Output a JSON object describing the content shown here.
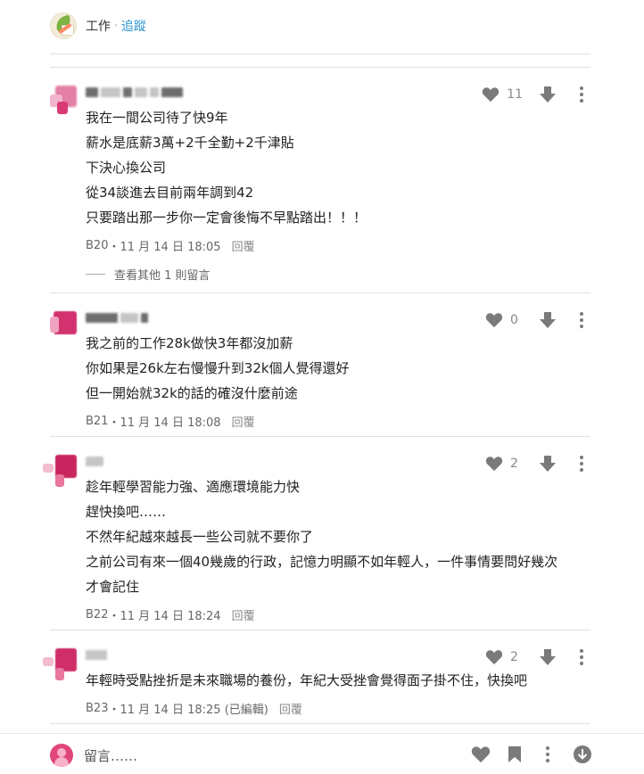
{
  "header": {
    "board": "工作",
    "separator": "‧",
    "follow": "追蹤"
  },
  "comments": [
    {
      "lines": [
        "我在一間公司待了快9年",
        "薪水是底薪3萬+2千全勤+2千津貼",
        "下決心換公司",
        "從34談進去目前兩年調到42",
        "只要踏出那一步你一定會後悔不早點踏出！！！"
      ],
      "floor": "B20",
      "time": "11 月 14 日 18:05",
      "likes": "11",
      "reply": "回覆",
      "more_replies": "查看其他 1 則留言"
    },
    {
      "lines": [
        "我之前的工作28k做快3年都沒加薪",
        "你如果是26k左右慢慢升到32k個人覺得還好",
        "但一開始就32k的話的確沒什麼前途"
      ],
      "floor": "B21",
      "time": "11 月 14 日 18:08",
      "likes": "0",
      "reply": "回覆"
    },
    {
      "lines": [
        "趁年輕學習能力強、適應環境能力快",
        "趕快換吧……",
        "不然年紀越來越長一些公司就不要你了",
        "之前公司有來一個40幾歲的行政，記憶力明顯不如年輕人，一件事情要問好幾次",
        "才會記住"
      ],
      "floor": "B22",
      "time": "11 月 14 日 18:24",
      "likes": "2",
      "reply": "回覆"
    },
    {
      "lines": [
        "年輕時受點挫折是未來職場的養份，年紀大受挫會覺得面子掛不住，快換吧"
      ],
      "floor": "B23",
      "time": "11 月 14 日 18:25 (已編輯)",
      "likes": "2",
      "reply": "回覆"
    }
  ],
  "meta_sep": "・",
  "footer": {
    "placeholder": "留言……"
  },
  "colors": {
    "link": "#3397cf",
    "icon": "#7a7a7a",
    "avatar_pink": "#d2326e"
  }
}
